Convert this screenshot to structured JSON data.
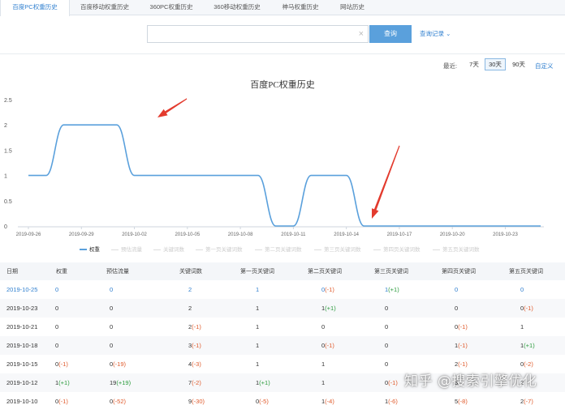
{
  "tabs": [
    {
      "label": "百度PC权重历史",
      "active": true
    },
    {
      "label": "百度移动权重历史",
      "active": false
    },
    {
      "label": "360PC权重历史",
      "active": false
    },
    {
      "label": "360移动权重历史",
      "active": false
    },
    {
      "label": "神马权重历史",
      "active": false
    },
    {
      "label": "网站历史",
      "active": false
    }
  ],
  "search": {
    "value": "",
    "placeholder": "",
    "button_label": "查询",
    "history_label": "查询记录"
  },
  "range": {
    "label": "最近:",
    "options": [
      "7天",
      "30天",
      "90天"
    ],
    "selected": "30天",
    "custom_label": "自定义"
  },
  "chart_title": "百度PC权重历史",
  "chart_data": {
    "type": "line",
    "title": "百度PC权重历史",
    "xlabel": "",
    "ylabel": "",
    "ylim": [
      0,
      2.5
    ],
    "yticks": [
      "0",
      "0.5",
      "1",
      "1.5",
      "2",
      "2.5"
    ],
    "x_tick_labels": [
      "2019-09-26",
      "2019-09-29",
      "2019-10-02",
      "2019-10-05",
      "2019-10-08",
      "2019-10-11",
      "2019-10-14",
      "2019-10-17",
      "2019-10-20",
      "2019-10-23"
    ],
    "x": [
      "2019-09-26",
      "2019-09-27",
      "2019-09-28",
      "2019-09-29",
      "2019-09-30",
      "2019-10-01",
      "2019-10-02",
      "2019-10-03",
      "2019-10-04",
      "2019-10-05",
      "2019-10-06",
      "2019-10-07",
      "2019-10-08",
      "2019-10-09",
      "2019-10-10",
      "2019-10-11",
      "2019-10-12",
      "2019-10-13",
      "2019-10-14",
      "2019-10-15",
      "2019-10-16",
      "2019-10-17",
      "2019-10-18",
      "2019-10-19",
      "2019-10-20",
      "2019-10-21",
      "2019-10-22",
      "2019-10-23",
      "2019-10-24",
      "2019-10-25"
    ],
    "series": [
      {
        "name": "权重",
        "color": "#5aa0dc",
        "values": [
          1,
          1,
          2,
          2,
          2,
          2,
          1,
          1,
          1,
          1,
          1,
          1,
          1,
          1,
          0,
          0,
          1,
          1,
          1,
          0,
          0,
          0,
          0,
          0,
          0,
          0,
          0,
          0,
          0,
          0
        ]
      }
    ],
    "grid": false,
    "legend_position": "bottom"
  },
  "legend": [
    "权重",
    "预估流量",
    "关键词数",
    "第一页关键词数",
    "第二页关键词数",
    "第三页关键词数",
    "第四页关键词数",
    "第五页关键词数"
  ],
  "table": {
    "columns": [
      "日期",
      "权重",
      "预估流量",
      "关键词数",
      "第一页关键词",
      "第二页关键词",
      "第三页关键词",
      "第四页关键词",
      "第五页关键词"
    ],
    "rows": [
      [
        {
          "v": "2019-10-25",
          "c": "date"
        },
        {
          "v": "0",
          "c": "blue"
        },
        {
          "v": "0",
          "c": "blue"
        },
        {
          "v": "2",
          "c": "blue"
        },
        {
          "v": "1",
          "c": "blue"
        },
        {
          "v": "0",
          "c": "blue",
          "d": "(-1)",
          "dc": "down"
        },
        {
          "v": "1",
          "c": "blue",
          "d": "(+1)",
          "dc": "up"
        },
        {
          "v": "0",
          "c": "blue"
        },
        {
          "v": "0",
          "c": "blue"
        }
      ],
      [
        {
          "v": "2019-10-23"
        },
        {
          "v": "0"
        },
        {
          "v": "0"
        },
        {
          "v": "2"
        },
        {
          "v": "1"
        },
        {
          "v": "1",
          "d": "(+1)",
          "dc": "up"
        },
        {
          "v": "0"
        },
        {
          "v": "0"
        },
        {
          "v": "0",
          "d": "(-1)",
          "dc": "down"
        }
      ],
      [
        {
          "v": "2019-10-21"
        },
        {
          "v": "0"
        },
        {
          "v": "0"
        },
        {
          "v": "2",
          "d": "(-1)",
          "dc": "down"
        },
        {
          "v": "1"
        },
        {
          "v": "0"
        },
        {
          "v": "0"
        },
        {
          "v": "0",
          "d": "(-1)",
          "dc": "down"
        },
        {
          "v": "1"
        }
      ],
      [
        {
          "v": "2019-10-18"
        },
        {
          "v": "0"
        },
        {
          "v": "0"
        },
        {
          "v": "3",
          "d": "(-1)",
          "dc": "down"
        },
        {
          "v": "1"
        },
        {
          "v": "0",
          "d": "(-1)",
          "dc": "down"
        },
        {
          "v": "0"
        },
        {
          "v": "1",
          "d": "(-1)",
          "dc": "down"
        },
        {
          "v": "1",
          "d": "(+1)",
          "dc": "up"
        }
      ],
      [
        {
          "v": "2019-10-15"
        },
        {
          "v": "0",
          "d": "(-1)",
          "dc": "down"
        },
        {
          "v": "0",
          "d": "(-19)",
          "dc": "down"
        },
        {
          "v": "4",
          "d": "(-3)",
          "dc": "down"
        },
        {
          "v": "1"
        },
        {
          "v": "1"
        },
        {
          "v": "0"
        },
        {
          "v": "2",
          "d": "(-1)",
          "dc": "down"
        },
        {
          "v": "0",
          "d": "(-2)",
          "dc": "down"
        }
      ],
      [
        {
          "v": "2019-10-12"
        },
        {
          "v": "1",
          "d": "(+1)",
          "dc": "up"
        },
        {
          "v": "19",
          "d": "(+19)",
          "dc": "up"
        },
        {
          "v": "7",
          "d": "(-2)",
          "dc": "down"
        },
        {
          "v": "1",
          "d": "(+1)",
          "dc": "up"
        },
        {
          "v": "1"
        },
        {
          "v": "0",
          "d": "(-1)",
          "dc": "down"
        },
        {
          "v": "3"
        },
        {
          "v": "2"
        }
      ],
      [
        {
          "v": "2019-10-10"
        },
        {
          "v": "0",
          "d": "(-1)",
          "dc": "down"
        },
        {
          "v": "0",
          "d": "(-52)",
          "dc": "down"
        },
        {
          "v": "9",
          "d": "(-30)",
          "dc": "down"
        },
        {
          "v": "0",
          "d": "(-5)",
          "dc": "down"
        },
        {
          "v": "1",
          "d": "(-4)",
          "dc": "down"
        },
        {
          "v": "1",
          "d": "(-6)",
          "dc": "down"
        },
        {
          "v": "5",
          "d": "(-8)",
          "dc": "down"
        },
        {
          "v": "2",
          "d": "(-7)",
          "dc": "down"
        }
      ]
    ]
  },
  "watermark": "知乎 @搜索引擎优化"
}
